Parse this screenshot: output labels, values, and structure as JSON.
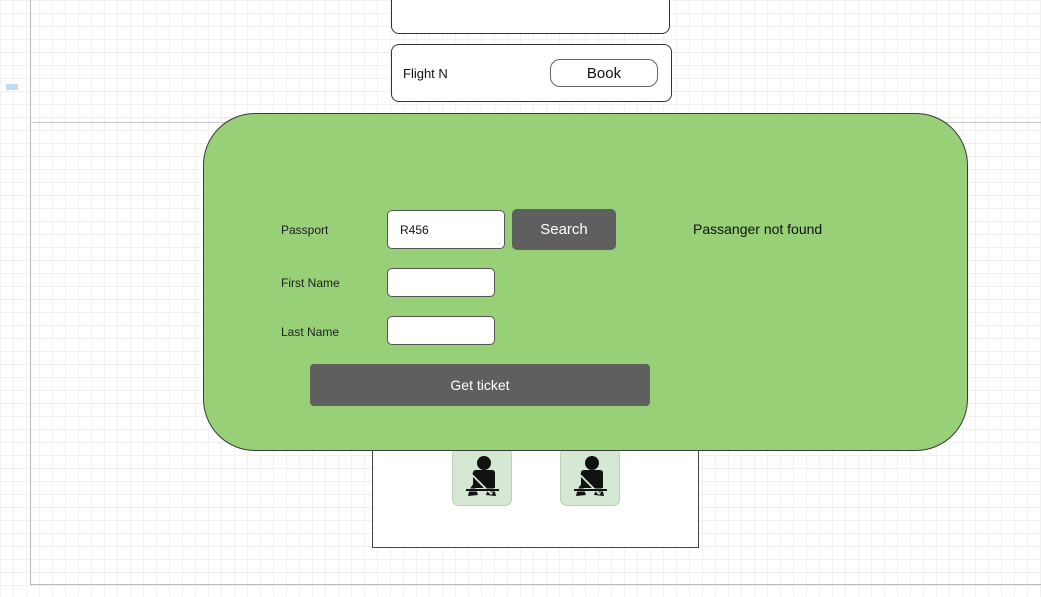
{
  "flights": {
    "current_label": "Flight N",
    "book_label": "Book"
  },
  "dialog": {
    "passport_label": "Passport",
    "passport_value": "R456",
    "search_label": "Search",
    "status_message": "Passanger not found",
    "first_name_label": "First Name",
    "first_name_value": "",
    "last_name_label": "Last Name",
    "last_name_value": "",
    "get_ticket_label": "Get ticket",
    "background_color": "#97d077"
  },
  "seats": {
    "icon": "seatbelt-icon",
    "seat_color": "#d5e8d4",
    "count": 2
  }
}
